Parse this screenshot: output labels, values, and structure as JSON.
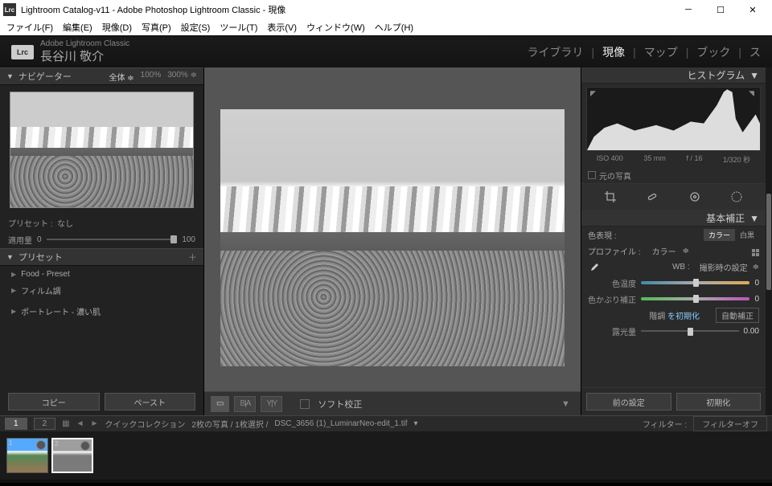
{
  "window": {
    "title": "Lightroom Catalog-v11 - Adobe Photoshop Lightroom Classic - 現像",
    "icon": "Lrc"
  },
  "menu": [
    "ファイル(F)",
    "編集(E)",
    "現像(D)",
    "写真(P)",
    "設定(S)",
    "ツール(T)",
    "表示(V)",
    "ウィンドウ(W)",
    "ヘルプ(H)"
  ],
  "brand": {
    "product": "Adobe Lightroom Classic",
    "user": "長谷川 敬介"
  },
  "modules": {
    "library": "ライブラリ",
    "develop": "現像",
    "map": "マップ",
    "book": "ブック",
    "more": "ス"
  },
  "nav": {
    "title": "ナビゲーター",
    "fit": "全体",
    "z100": "100%",
    "z300": "300%"
  },
  "preset_block": {
    "preset_lbl": "プリセット :",
    "preset_val": "なし",
    "amount_lbl": "適用量",
    "amount_min": "0",
    "amount_max": "100"
  },
  "presets": {
    "title": "プリセット",
    "items": [
      "Food - Preset",
      "フィルム調",
      "ポートレート - 濃い肌"
    ]
  },
  "left_buttons": {
    "copy": "コピー",
    "paste": "ペースト"
  },
  "toolbar": {
    "soft": "ソフト校正"
  },
  "right": {
    "histogram_title": "ヒストグラム",
    "exif": {
      "iso": "ISO 400",
      "focal": "35 mm",
      "aperture": "f / 16",
      "shutter": "1/320 秒"
    },
    "original": "元の写真",
    "basic_title": "基本補正",
    "treatment_lbl": "色表現 :",
    "treatment_color": "カラー",
    "treatment_bw": "白黒",
    "profile_lbl": "プロファイル :",
    "profile_val": "カラー",
    "wb_lbl": "WB :",
    "wb_val": "撮影時の設定",
    "temp_lbl": "色温度",
    "temp_val": "0",
    "tint_lbl": "色かぶり補正",
    "tint_val": "0",
    "tone_lbl": "階調",
    "tone_reset": "を初期化",
    "auto": "自動補正",
    "exposure_lbl": "露光量",
    "exposure_val": "0.00",
    "prev": "前の設定",
    "reset": "初期化"
  },
  "filmstrip": {
    "collection": "クイックコレクション",
    "summary": "2枚の写真 / 1枚選択 /",
    "filename": "DSC_3656 (1)_LuminarNeo-edit_1.tif",
    "filter_lbl": "フィルター :",
    "filter_val": "フィルターオフ"
  },
  "thumbs": {
    "n1": "1",
    "n2": "2"
  }
}
